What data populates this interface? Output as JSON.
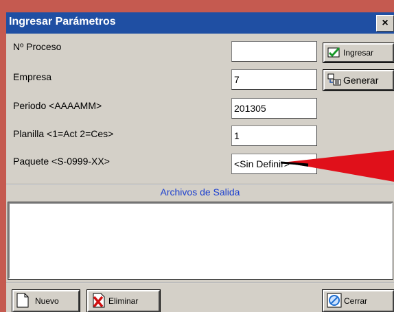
{
  "window": {
    "title": "Ingresar Parámetros",
    "close_label": "×"
  },
  "form": {
    "labels": {
      "proceso": "Nº Proceso",
      "empresa": "Empresa",
      "periodo": "Periodo <AAAAMM>",
      "planilla": "Planilla <1=Act 2=Ces>",
      "paquete": "Paquete <S-0999-XX>"
    },
    "values": {
      "proceso": "",
      "empresa": "7",
      "periodo": "201305",
      "planilla": "1",
      "paquete": "<Sin Definir>"
    }
  },
  "buttons": {
    "ingresar": "Ingresar",
    "generar": "Generar",
    "nuevo": "Nuevo",
    "eliminar": "Eliminar",
    "cerrar": "Cerrar"
  },
  "output_section": {
    "title": "Archivos de Salida",
    "items": []
  },
  "icons": {
    "ingresar": "check-icon",
    "generar": "generate-icon",
    "nuevo": "new-document-icon",
    "eliminar": "delete-icon",
    "cerrar": "close-circle-icon"
  },
  "colors": {
    "titlebar": "#1f4fa3",
    "section_title": "#1a3ecf",
    "annotation_arrow": "#e0101a"
  }
}
